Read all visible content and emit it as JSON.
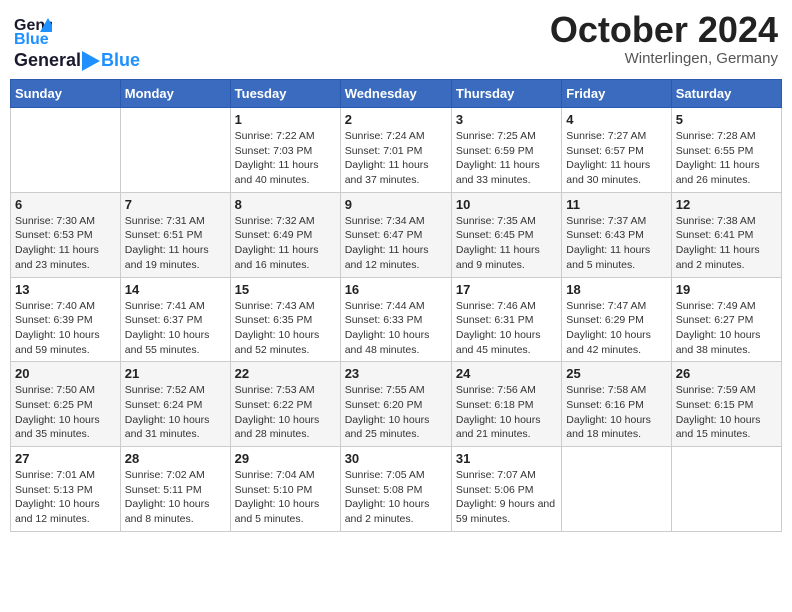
{
  "header": {
    "logo_general": "General",
    "logo_blue": "Blue",
    "month": "October 2024",
    "location": "Winterlingen, Germany"
  },
  "weekdays": [
    "Sunday",
    "Monday",
    "Tuesday",
    "Wednesday",
    "Thursday",
    "Friday",
    "Saturday"
  ],
  "weeks": [
    [
      {
        "day": "",
        "sunrise": "",
        "sunset": "",
        "daylight": ""
      },
      {
        "day": "",
        "sunrise": "",
        "sunset": "",
        "daylight": ""
      },
      {
        "day": "1",
        "sunrise": "Sunrise: 7:22 AM",
        "sunset": "Sunset: 7:03 PM",
        "daylight": "Daylight: 11 hours and 40 minutes."
      },
      {
        "day": "2",
        "sunrise": "Sunrise: 7:24 AM",
        "sunset": "Sunset: 7:01 PM",
        "daylight": "Daylight: 11 hours and 37 minutes."
      },
      {
        "day": "3",
        "sunrise": "Sunrise: 7:25 AM",
        "sunset": "Sunset: 6:59 PM",
        "daylight": "Daylight: 11 hours and 33 minutes."
      },
      {
        "day": "4",
        "sunrise": "Sunrise: 7:27 AM",
        "sunset": "Sunset: 6:57 PM",
        "daylight": "Daylight: 11 hours and 30 minutes."
      },
      {
        "day": "5",
        "sunrise": "Sunrise: 7:28 AM",
        "sunset": "Sunset: 6:55 PM",
        "daylight": "Daylight: 11 hours and 26 minutes."
      }
    ],
    [
      {
        "day": "6",
        "sunrise": "Sunrise: 7:30 AM",
        "sunset": "Sunset: 6:53 PM",
        "daylight": "Daylight: 11 hours and 23 minutes."
      },
      {
        "day": "7",
        "sunrise": "Sunrise: 7:31 AM",
        "sunset": "Sunset: 6:51 PM",
        "daylight": "Daylight: 11 hours and 19 minutes."
      },
      {
        "day": "8",
        "sunrise": "Sunrise: 7:32 AM",
        "sunset": "Sunset: 6:49 PM",
        "daylight": "Daylight: 11 hours and 16 minutes."
      },
      {
        "day": "9",
        "sunrise": "Sunrise: 7:34 AM",
        "sunset": "Sunset: 6:47 PM",
        "daylight": "Daylight: 11 hours and 12 minutes."
      },
      {
        "day": "10",
        "sunrise": "Sunrise: 7:35 AM",
        "sunset": "Sunset: 6:45 PM",
        "daylight": "Daylight: 11 hours and 9 minutes."
      },
      {
        "day": "11",
        "sunrise": "Sunrise: 7:37 AM",
        "sunset": "Sunset: 6:43 PM",
        "daylight": "Daylight: 11 hours and 5 minutes."
      },
      {
        "day": "12",
        "sunrise": "Sunrise: 7:38 AM",
        "sunset": "Sunset: 6:41 PM",
        "daylight": "Daylight: 11 hours and 2 minutes."
      }
    ],
    [
      {
        "day": "13",
        "sunrise": "Sunrise: 7:40 AM",
        "sunset": "Sunset: 6:39 PM",
        "daylight": "Daylight: 10 hours and 59 minutes."
      },
      {
        "day": "14",
        "sunrise": "Sunrise: 7:41 AM",
        "sunset": "Sunset: 6:37 PM",
        "daylight": "Daylight: 10 hours and 55 minutes."
      },
      {
        "day": "15",
        "sunrise": "Sunrise: 7:43 AM",
        "sunset": "Sunset: 6:35 PM",
        "daylight": "Daylight: 10 hours and 52 minutes."
      },
      {
        "day": "16",
        "sunrise": "Sunrise: 7:44 AM",
        "sunset": "Sunset: 6:33 PM",
        "daylight": "Daylight: 10 hours and 48 minutes."
      },
      {
        "day": "17",
        "sunrise": "Sunrise: 7:46 AM",
        "sunset": "Sunset: 6:31 PM",
        "daylight": "Daylight: 10 hours and 45 minutes."
      },
      {
        "day": "18",
        "sunrise": "Sunrise: 7:47 AM",
        "sunset": "Sunset: 6:29 PM",
        "daylight": "Daylight: 10 hours and 42 minutes."
      },
      {
        "day": "19",
        "sunrise": "Sunrise: 7:49 AM",
        "sunset": "Sunset: 6:27 PM",
        "daylight": "Daylight: 10 hours and 38 minutes."
      }
    ],
    [
      {
        "day": "20",
        "sunrise": "Sunrise: 7:50 AM",
        "sunset": "Sunset: 6:25 PM",
        "daylight": "Daylight: 10 hours and 35 minutes."
      },
      {
        "day": "21",
        "sunrise": "Sunrise: 7:52 AM",
        "sunset": "Sunset: 6:24 PM",
        "daylight": "Daylight: 10 hours and 31 minutes."
      },
      {
        "day": "22",
        "sunrise": "Sunrise: 7:53 AM",
        "sunset": "Sunset: 6:22 PM",
        "daylight": "Daylight: 10 hours and 28 minutes."
      },
      {
        "day": "23",
        "sunrise": "Sunrise: 7:55 AM",
        "sunset": "Sunset: 6:20 PM",
        "daylight": "Daylight: 10 hours and 25 minutes."
      },
      {
        "day": "24",
        "sunrise": "Sunrise: 7:56 AM",
        "sunset": "Sunset: 6:18 PM",
        "daylight": "Daylight: 10 hours and 21 minutes."
      },
      {
        "day": "25",
        "sunrise": "Sunrise: 7:58 AM",
        "sunset": "Sunset: 6:16 PM",
        "daylight": "Daylight: 10 hours and 18 minutes."
      },
      {
        "day": "26",
        "sunrise": "Sunrise: 7:59 AM",
        "sunset": "Sunset: 6:15 PM",
        "daylight": "Daylight: 10 hours and 15 minutes."
      }
    ],
    [
      {
        "day": "27",
        "sunrise": "Sunrise: 7:01 AM",
        "sunset": "Sunset: 5:13 PM",
        "daylight": "Daylight: 10 hours and 12 minutes."
      },
      {
        "day": "28",
        "sunrise": "Sunrise: 7:02 AM",
        "sunset": "Sunset: 5:11 PM",
        "daylight": "Daylight: 10 hours and 8 minutes."
      },
      {
        "day": "29",
        "sunrise": "Sunrise: 7:04 AM",
        "sunset": "Sunset: 5:10 PM",
        "daylight": "Daylight: 10 hours and 5 minutes."
      },
      {
        "day": "30",
        "sunrise": "Sunrise: 7:05 AM",
        "sunset": "Sunset: 5:08 PM",
        "daylight": "Daylight: 10 hours and 2 minutes."
      },
      {
        "day": "31",
        "sunrise": "Sunrise: 7:07 AM",
        "sunset": "Sunset: 5:06 PM",
        "daylight": "Daylight: 9 hours and 59 minutes."
      },
      {
        "day": "",
        "sunrise": "",
        "sunset": "",
        "daylight": ""
      },
      {
        "day": "",
        "sunrise": "",
        "sunset": "",
        "daylight": ""
      }
    ]
  ]
}
